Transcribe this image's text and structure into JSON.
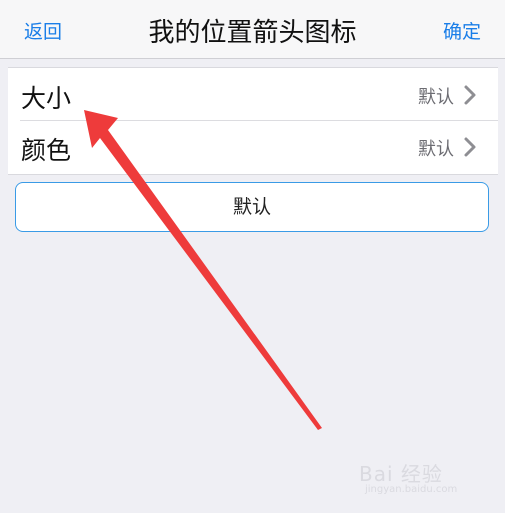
{
  "navbar": {
    "back_label": "返回",
    "title": "我的位置箭头图标",
    "confirm_label": "确定"
  },
  "settings": {
    "rows": [
      {
        "label": "大小",
        "value": "默认"
      },
      {
        "label": "颜色",
        "value": "默认"
      }
    ]
  },
  "default_button": {
    "label": "默认"
  },
  "annotation": {
    "arrow_color": "#ee3b3b",
    "arrow_icon": "red-annotation-arrow"
  },
  "watermark": {
    "text": "Bai 经验",
    "sub": "jingyan.baidu.com"
  },
  "colors": {
    "accent": "#1a7ee8",
    "background": "#efeff4"
  }
}
